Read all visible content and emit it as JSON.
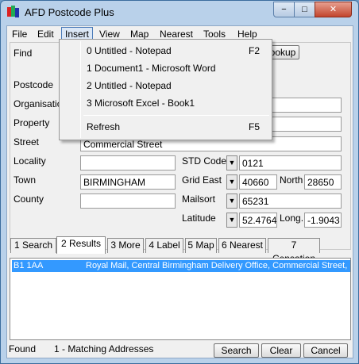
{
  "window": {
    "title": "AFD Postcode Plus",
    "minimize": "−",
    "maximize": "□",
    "close": "✕"
  },
  "menu": {
    "items": [
      "File",
      "Edit",
      "Insert",
      "View",
      "Map",
      "Nearest",
      "Tools",
      "Help"
    ],
    "active": "Insert"
  },
  "insert_menu": {
    "items": [
      {
        "label": "0 Untitled - Notepad",
        "shortcut": "F2"
      },
      {
        "label": "1 Document1 - Microsoft Word",
        "shortcut": ""
      },
      {
        "label": "2 Untitled - Notepad",
        "shortcut": ""
      },
      {
        "label": "3 Microsoft Excel - Book1",
        "shortcut": ""
      },
      {
        "label": "Refresh",
        "shortcut": "F5"
      }
    ]
  },
  "form": {
    "find_label": "Find",
    "lookup_button": "ookup",
    "postcode_label": "Postcode",
    "organisation_label": "Organisation",
    "property_label": "Property",
    "street_label": "Street",
    "street_value": "Commercial Street",
    "locality_label": "Locality",
    "locality_value": "",
    "town_label": "Town",
    "town_value": "BIRMINGHAM",
    "county_label": "County",
    "county_value": "",
    "std_code_label": "STD Code",
    "std_code_value": "0121",
    "grid_east_label": "Grid East",
    "grid_east_value": "40660",
    "north_label": "North",
    "north_value": "28650",
    "mailsort_label": "Mailsort",
    "mailsort_value": "65231",
    "latitude_label": "Latitude",
    "latitude_value": "52.4764",
    "long_label": "Long.",
    "long_value": "-1.9043"
  },
  "tabs": [
    {
      "label": "1 Search"
    },
    {
      "label": "2 Results"
    },
    {
      "label": "3 More"
    },
    {
      "label": "4 Label"
    },
    {
      "label": "5 Map"
    },
    {
      "label": "6 Nearest"
    },
    {
      "label": "7 Censation"
    }
  ],
  "selected_tab": "2 Results",
  "results": [
    {
      "postcode": "B1 1AA",
      "address": "Royal Mail, Central Birmingham Delivery Office, Commercial Street, BIR"
    }
  ],
  "status": {
    "found_label": "Found",
    "found_text": "1 - Matching Addresses",
    "search_button": "Search",
    "clear_button": "Clear",
    "cancel_button": "Cancel"
  },
  "colors": {
    "selection": "#3399ff",
    "menu_highlight": "#dbe7f6",
    "window_frame": "#b9d1ea"
  }
}
